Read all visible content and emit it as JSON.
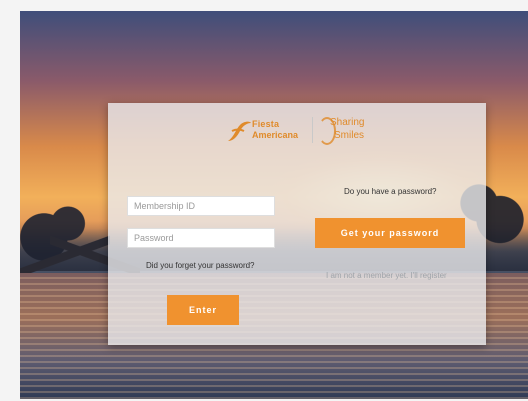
{
  "brand": {
    "logo_line1": "Fiesta",
    "logo_line2": "Americana",
    "program_line1": "Sharing",
    "program_line2": "Smiles"
  },
  "login": {
    "membership_placeholder": "Membership ID",
    "password_placeholder": "Password",
    "forgot_link": "Did you forget your password?",
    "enter_button": "Enter"
  },
  "signup": {
    "prompt": "Do you have a password?",
    "get_password_button": "Get your password",
    "not_member": "I am not a member yet. I'll register"
  },
  "colors": {
    "accent": "#f0922f",
    "panel": "#ebebee"
  }
}
